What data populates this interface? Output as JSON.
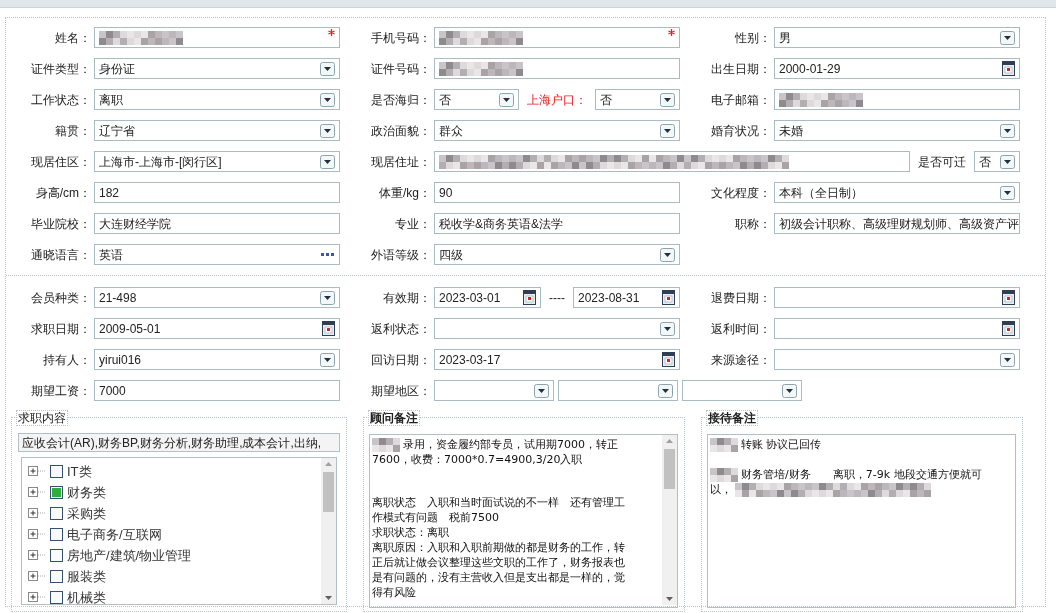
{
  "form": {
    "sections": [
      {
        "rows": [
          [
            {
              "label": "姓名：",
              "controls": [
                {
                  "kind": "text",
                  "blurred": true,
                  "required": true
                }
              ]
            },
            {
              "label": "手机号码：",
              "controls": [
                {
                  "kind": "text",
                  "blurred": true,
                  "required": true
                }
              ]
            },
            {
              "label": "性别：",
              "controls": [
                {
                  "kind": "select",
                  "value": "男"
                }
              ]
            }
          ],
          [
            {
              "label": "证件类型：",
              "controls": [
                {
                  "kind": "select",
                  "value": "身份证"
                }
              ]
            },
            {
              "label": "证件号码：",
              "controls": [
                {
                  "kind": "text",
                  "blurred": true
                }
              ]
            },
            {
              "label": "出生日期：",
              "controls": [
                {
                  "kind": "date",
                  "value": "2000-01-29"
                }
              ]
            }
          ],
          [
            {
              "label": "工作状态：",
              "controls": [
                {
                  "kind": "select",
                  "value": "离职"
                }
              ]
            },
            {
              "label": "是否海归：",
              "controls": [
                {
                  "kind": "select",
                  "value": "否"
                },
                {
                  "kind": "label",
                  "value": "上海户口：",
                  "emphasized": true
                },
                {
                  "kind": "select",
                  "value": "否"
                }
              ]
            },
            {
              "label": "电子邮箱：",
              "controls": [
                {
                  "kind": "text",
                  "blurred": true
                }
              ]
            }
          ],
          [
            {
              "label": "籍贯：",
              "controls": [
                {
                  "kind": "select",
                  "value": "辽宁省"
                }
              ]
            },
            {
              "label": "政治面貌：",
              "controls": [
                {
                  "kind": "select",
                  "value": "群众"
                }
              ]
            },
            {
              "label": "婚育状况：",
              "controls": [
                {
                  "kind": "select",
                  "value": "未婚"
                }
              ]
            }
          ],
          [
            {
              "label": "现居住区：",
              "controls": [
                {
                  "kind": "select",
                  "value": "上海市-上海市-[闵行区]"
                }
              ]
            },
            {
              "label": "现居住址：",
              "controls": [
                {
                  "kind": "text",
                  "blurred": true
                },
                {
                  "kind": "label",
                  "value": "是否可迁",
                  "emphasized": false
                },
                {
                  "kind": "select",
                  "value": "否"
                }
              ]
            }
          ],
          [
            {
              "label": "身高/cm：",
              "controls": [
                {
                  "kind": "text",
                  "value": "182"
                }
              ]
            },
            {
              "label": "体重/kg：",
              "controls": [
                {
                  "kind": "text",
                  "value": "90"
                }
              ]
            },
            {
              "label": "文化程度：",
              "controls": [
                {
                  "kind": "select",
                  "value": "本科（全日制）"
                }
              ]
            }
          ],
          [
            {
              "label": "毕业院校：",
              "controls": [
                {
                  "kind": "text",
                  "value": "大连财经学院"
                }
              ]
            },
            {
              "label": "专业：",
              "controls": [
                {
                  "kind": "text",
                  "value": "税收学&商务英语&法学"
                }
              ]
            },
            {
              "label": "职称：",
              "controls": [
                {
                  "kind": "text",
                  "value": "初级会计职称、高级理财规划师、高级资产评"
                }
              ]
            }
          ],
          [
            {
              "label": "通晓语言：",
              "controls": [
                {
                  "kind": "lookup",
                  "value": "英语"
                }
              ]
            },
            {
              "label": "外语等级：",
              "controls": [
                {
                  "kind": "select",
                  "value": "四级"
                }
              ]
            }
          ]
        ]
      },
      {
        "rows": [
          [
            {
              "label": "会员种类：",
              "controls": [
                {
                  "kind": "select",
                  "value": "21-498"
                }
              ]
            },
            {
              "label": "有效期：",
              "controls": [
                {
                  "kind": "date",
                  "value": "2023-03-01"
                },
                {
                  "kind": "label",
                  "value": "----",
                  "emphasized": false
                },
                {
                  "kind": "date",
                  "value": "2023-08-31"
                }
              ]
            },
            {
              "label": "退费日期：",
              "controls": [
                {
                  "kind": "date"
                }
              ]
            }
          ],
          [
            {
              "label": "求职日期：",
              "controls": [
                {
                  "kind": "date",
                  "value": "2009-05-01"
                }
              ]
            },
            {
              "label": "返利状态：",
              "controls": [
                {
                  "kind": "select"
                }
              ]
            },
            {
              "label": "返利时间：",
              "controls": [
                {
                  "kind": "date"
                }
              ]
            }
          ],
          [
            {
              "label": "持有人：",
              "controls": [
                {
                  "kind": "select",
                  "value": "yirui016"
                }
              ]
            },
            {
              "label": "回访日期：",
              "controls": [
                {
                  "kind": "date",
                  "value": "2023-03-17"
                }
              ]
            },
            {
              "label": "来源途径：",
              "controls": [
                {
                  "kind": "select"
                }
              ]
            }
          ],
          [
            {
              "label": "期望工资：",
              "controls": [
                {
                  "kind": "text",
                  "value": "7000"
                }
              ]
            },
            {
              "label": "期望地区：",
              "controls": [
                {
                  "kind": "select"
                },
                {
                  "kind": "select"
                },
                {
                  "kind": "select"
                }
              ]
            }
          ]
        ]
      }
    ]
  },
  "job_content": {
    "title": "求职内容",
    "summary": "应收会计(AR),财务BP,财务分析,财务助理,成本会计,出纳,",
    "items": [
      {
        "label": "IT类",
        "checked": false,
        "expanded": false
      },
      {
        "label": "财务类",
        "checked": true,
        "expanded": false
      },
      {
        "label": "采购类",
        "checked": false,
        "expanded": false
      },
      {
        "label": "电子商务/互联网",
        "checked": false,
        "expanded": false
      },
      {
        "label": "房地产/建筑/物业管理",
        "checked": false,
        "expanded": false
      },
      {
        "label": "服装类",
        "checked": false,
        "expanded": false
      },
      {
        "label": "机械类",
        "checked": false,
        "expanded": false
      }
    ]
  },
  "notes": [
    {
      "title": "顾问备注",
      "scrollbar": true,
      "paragraphs": [
        {
          "lines": [
            {
              "text": "录用，资金履约部专员，试用期7000，转正",
              "blur_before": true,
              "blur_after": false
            },
            {
              "text": "7600，收费：7000*0.7=4900,3/20入职",
              "blur_before": false,
              "blur_after": false
            }
          ]
        },
        {
          "lines": [
            {
              "text": "离职状态　入职和当时面试说的不一样　还有管理工",
              "blur_before": false,
              "blur_after": false
            },
            {
              "text": "作模式有问题　税前7500",
              "blur_before": false,
              "blur_after": false
            },
            {
              "text": "求职状态：离职",
              "blur_before": false,
              "blur_after": false
            },
            {
              "text": "离职原因：入职和入职前期做的都是财务的工作，转",
              "blur_before": false,
              "blur_after": false
            },
            {
              "text": "正后就让做会议整理这些文职的工作了，财务报表也",
              "blur_before": false,
              "blur_after": false
            },
            {
              "text": "是有问题的，没有主营收入但是支出都是一样的，觉",
              "blur_before": false,
              "blur_after": false
            },
            {
              "text": "得有风险",
              "blur_before": false,
              "blur_after": false
            }
          ]
        }
      ]
    },
    {
      "title": "接待备注",
      "scrollbar": false,
      "paragraphs": [
        {
          "lines": [
            {
              "text": "转账 协议已回传",
              "blur_before": true,
              "blur_after": false
            }
          ]
        },
        {
          "lines": [
            {
              "text": "财务管培/财务　　离职，7-9k 地段交通方便就可",
              "blur_before": true,
              "blur_after": false
            },
            {
              "text": "以，",
              "blur_before": false,
              "blur_after": true
            }
          ]
        }
      ]
    }
  ]
}
